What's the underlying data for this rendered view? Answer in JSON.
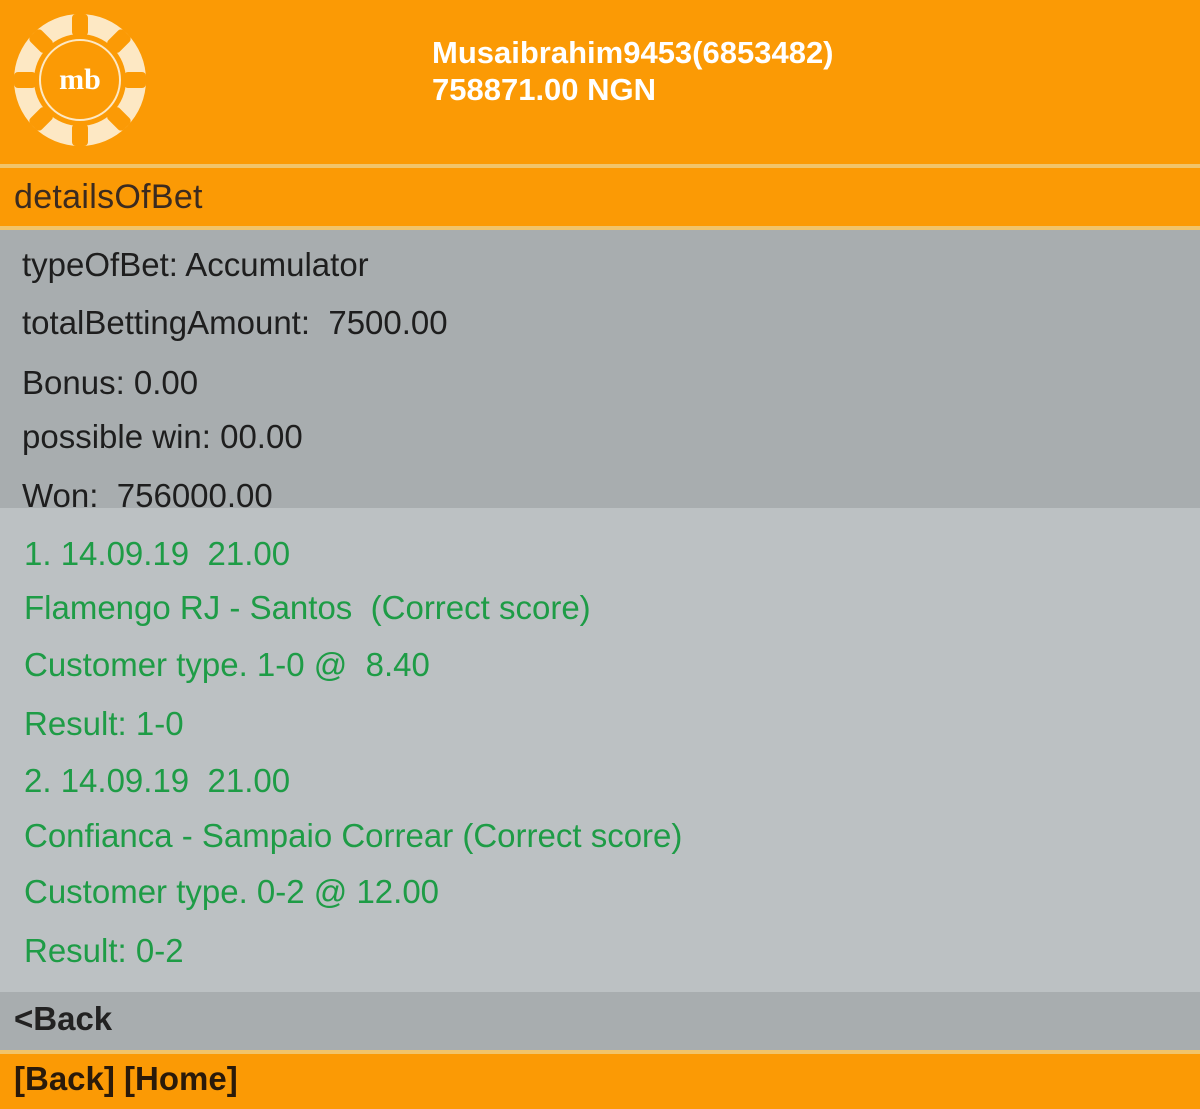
{
  "header": {
    "username": "Musaibrahim9453(6853482)",
    "balance": "758871.00 NGN",
    "logo_text": "mb"
  },
  "section": {
    "title": "detailsOfBet"
  },
  "summary": {
    "type_of_bet": "typeOfBet: Accumulator",
    "total_amount": "totalBettingAmount:  7500.00",
    "bonus": "Bonus: 0.00",
    "possible_win": "possible win: 00.00",
    "won": "Won:  756000.00"
  },
  "events": [
    {
      "datetime": "1. 14.09.19  21.00",
      "match": "Flamengo RJ - Santos  (Correct score)",
      "customer_type": "Customer type. 1-0 @  8.40",
      "result": "Result: 1-0"
    },
    {
      "datetime": "2. 14.09.19  21.00",
      "match": "Confianca - Sampaio Correar (Correct score)",
      "customer_type": "Customer type. 0-2 @ 12.00",
      "result": "Result: 0-2"
    }
  ],
  "nav": {
    "back_link": "<Back",
    "footer_back": "[Back]",
    "footer_home": "[Home]"
  },
  "colors": {
    "brand_orange": "#fb9a05",
    "event_green": "#1e9c46",
    "panel_gray": "#a8adaf"
  }
}
